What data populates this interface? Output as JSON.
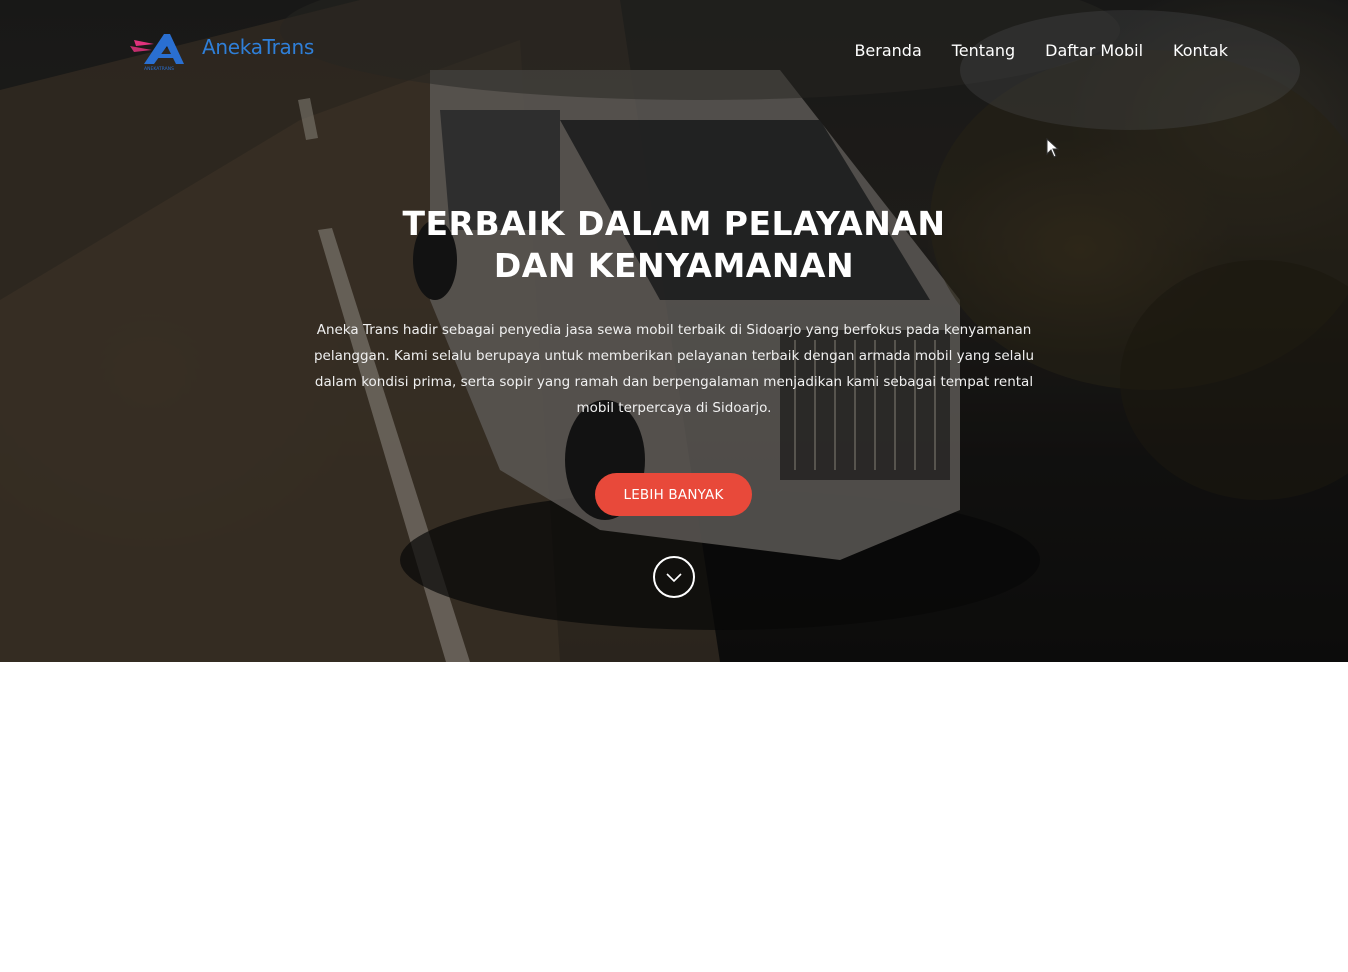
{
  "brand": {
    "name": "AnekaTrans",
    "mark_caption": "ANEKATRANS",
    "colors": {
      "text": "#2f7fd8",
      "mark_blue": "#2a6fd1",
      "mark_pink": "#e0337d"
    }
  },
  "nav": {
    "items": [
      {
        "label": "Beranda"
      },
      {
        "label": "Tentang"
      },
      {
        "label": "Daftar Mobil"
      },
      {
        "label": "Kontak"
      }
    ]
  },
  "hero": {
    "title_line1": "TERBAIK DALAM PELAYANAN",
    "title_line2": "DAN KENYAMANAN",
    "description": "Aneka Trans hadir sebagai penyedia jasa sewa mobil terbaik di Sidoarjo yang berfokus pada kenyamanan pelanggan. Kami selalu berupaya untuk memberikan pelayanan terbaik dengan armada mobil yang selalu dalam kondisi prima, serta sopir yang ramah dan berpengalaman menjadikan kami sebagai tempat rental mobil terpercaya di Sidoarjo.",
    "cta_label": "LEBIH BANYAK",
    "scroll_icon": "chevron-down-icon",
    "colors": {
      "cta": "#e8493a"
    }
  }
}
